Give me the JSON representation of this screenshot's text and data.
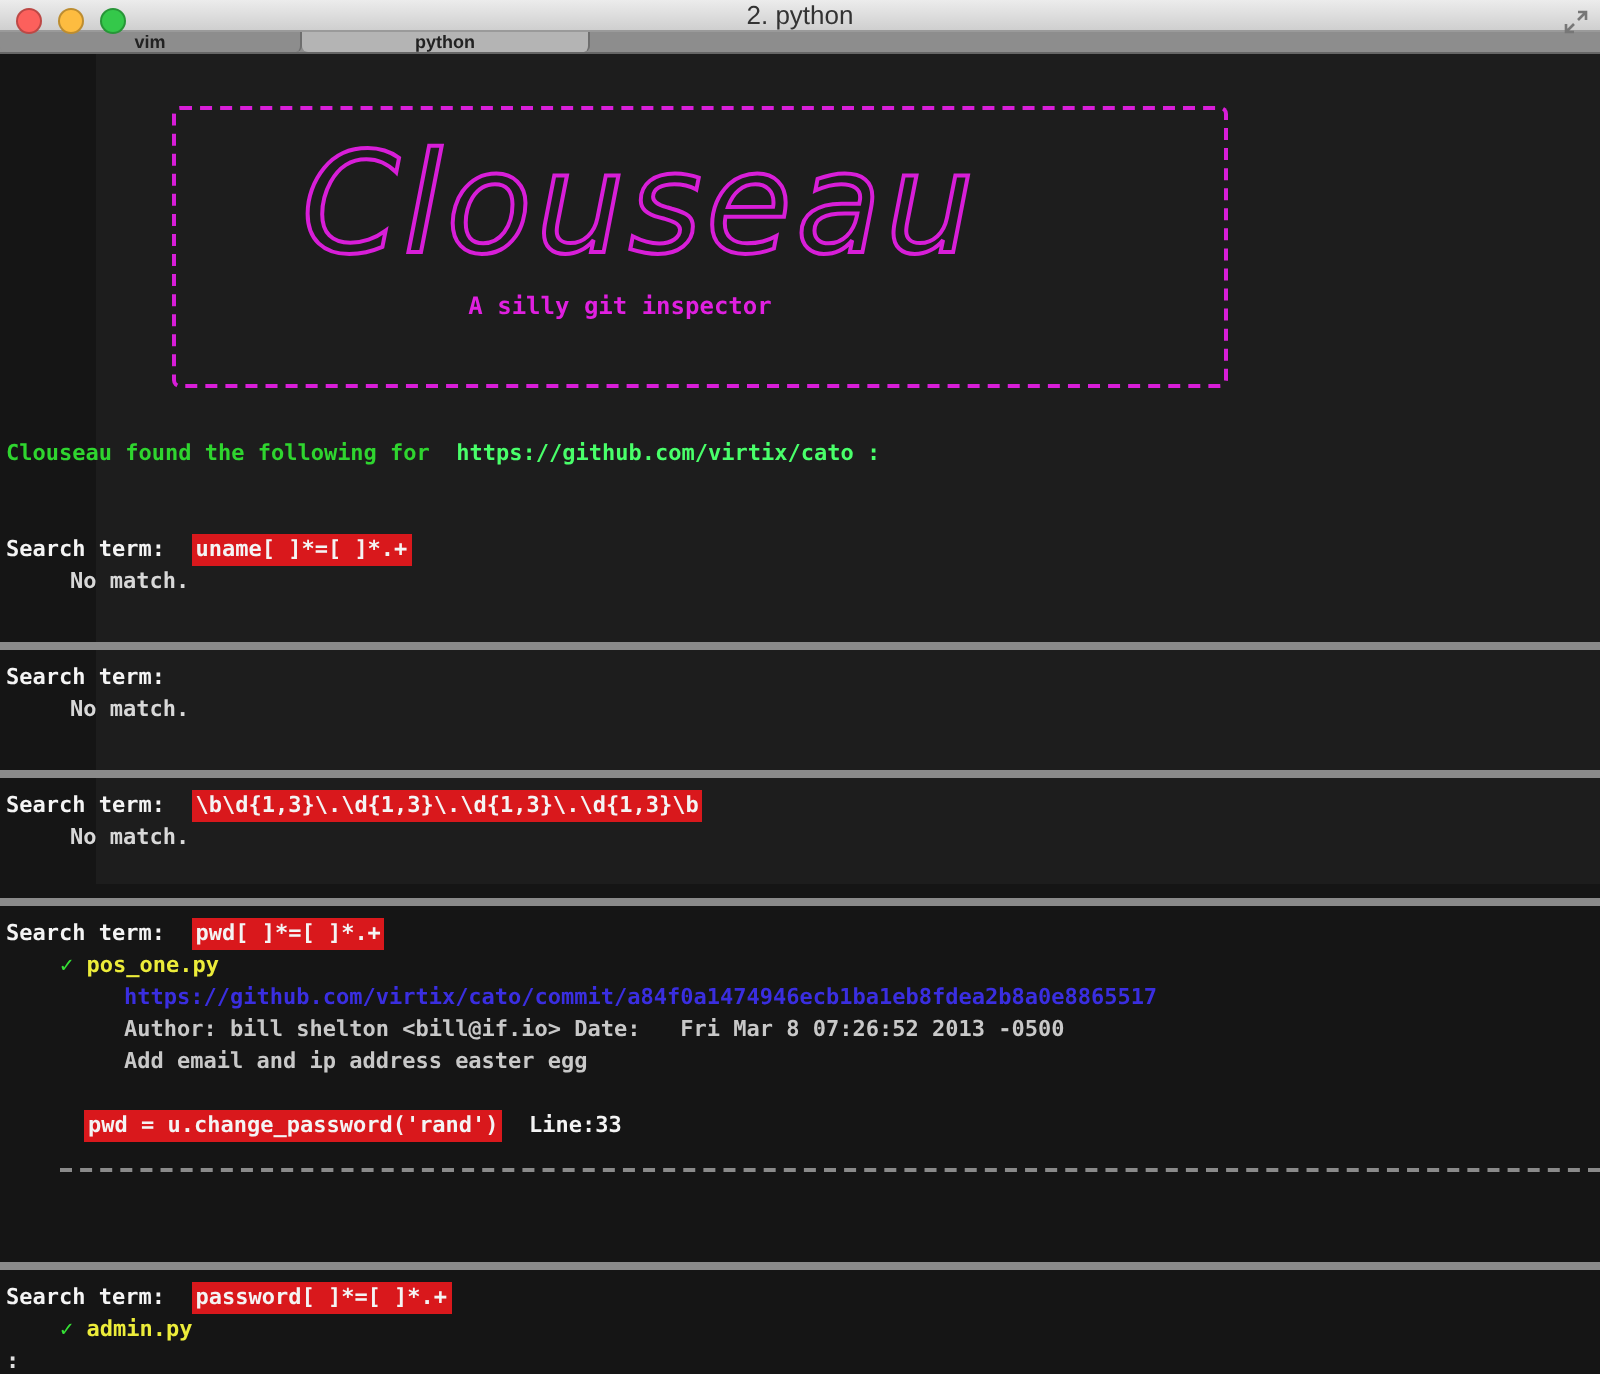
{
  "window": {
    "title": "2. python"
  },
  "tabs": [
    {
      "label": "vim",
      "selected": false
    },
    {
      "label": "python",
      "selected": true
    }
  ],
  "banner": {
    "logo": "Clouseau",
    "tagline": "A silly git inspector"
  },
  "intro": {
    "text": "Clouseau found the following for",
    "repo": "https://github.com/virtix/cato :"
  },
  "results": [
    {
      "label": "Search term:",
      "term": "uname[ ]*=[ ]*.+",
      "status": "No match."
    },
    {
      "label": "Search term:",
      "status": "No match."
    },
    {
      "label": "Search term:",
      "term": "\\b\\d{1,3}\\.\\d{1,3}\\.\\d{1,3}\\.\\d{1,3}\\b",
      "status": "No match."
    },
    {
      "label": "Search term:",
      "term": "pwd[ ]*=[ ]*.+",
      "matches": [
        {
          "mark": "✓",
          "file": "pos_one.py",
          "commit": "https://github.com/virtix/cato/commit/a84f0a1474946ecb1ba1eb8fdea2b8a0e8865517",
          "author": "Author: bill shelton <bill@if.io> Date:   Fri Mar 8 07:26:52 2013 -0500",
          "message": "Add email and ip address easter egg",
          "code": "pwd = u.change_password('rand')",
          "line": "Line:33"
        }
      ]
    },
    {
      "label": "Search term:",
      "term": "password[ ]*=[ ]*.+",
      "matches": [
        {
          "mark": "✓",
          "file": "admin.py"
        }
      ]
    }
  ],
  "prompt": ":"
}
